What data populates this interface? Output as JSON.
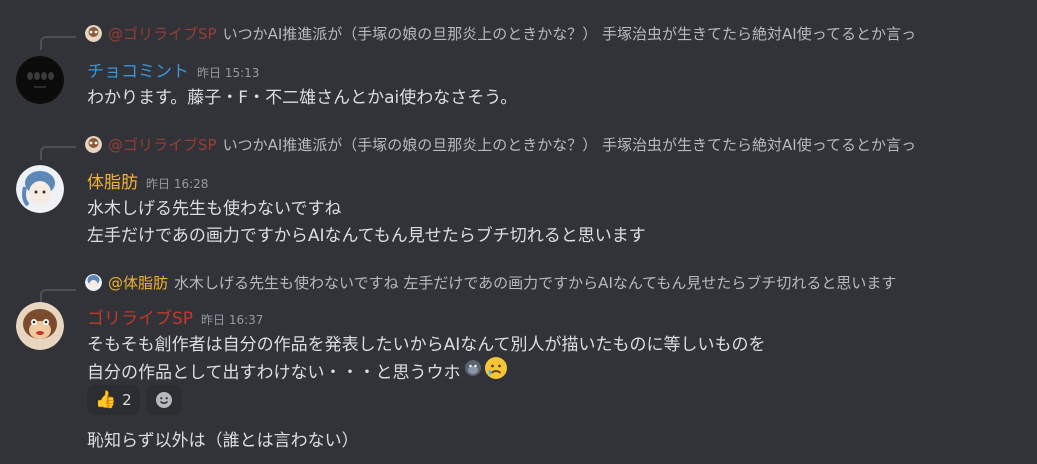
{
  "messages": [
    {
      "reply": {
        "author": "@ゴリライブSP",
        "text": "いつかAI推進派が（手塚の娘の旦那炎上のときかな？） 手塚治虫が生きてたら絶対AI使ってるとか言っ"
      },
      "author": "チョコミント",
      "timestamp": "昨日 15:13",
      "lines": [
        "わかります。藤子・F・不二雄さんとかai使わなさそう。"
      ]
    },
    {
      "reply": {
        "author": "@ゴリライブSP",
        "text": "いつかAI推進派が（手塚の娘の旦那炎上のときかな？） 手塚治虫が生きてたら絶対AI使ってるとか言っ"
      },
      "author": "体脂肪",
      "timestamp": "昨日 16:28",
      "lines": [
        "水木しげる先生も使わないですね",
        "左手だけであの画力ですからAIなんてもん見せたらブチ切れると思います"
      ]
    },
    {
      "reply": {
        "author": "@体脂肪",
        "text": "水木しげる先生も使わないですね 左手だけであの画力ですからAIなんてもん見せたらブチ切れると思います"
      },
      "author": "ゴリライブSP",
      "timestamp": "昨日 16:37",
      "lines": [
        "そもそも創作者は自分の作品を発表したいからAIなんて別人が描いたものに等しいものを",
        "自分の作品として出すわけない・・・と思うウホ"
      ],
      "reactions": [
        {
          "emoji": "👍",
          "count": "2"
        }
      ],
      "followup": "恥知らず以外は（誰とは言わない）"
    }
  ]
}
